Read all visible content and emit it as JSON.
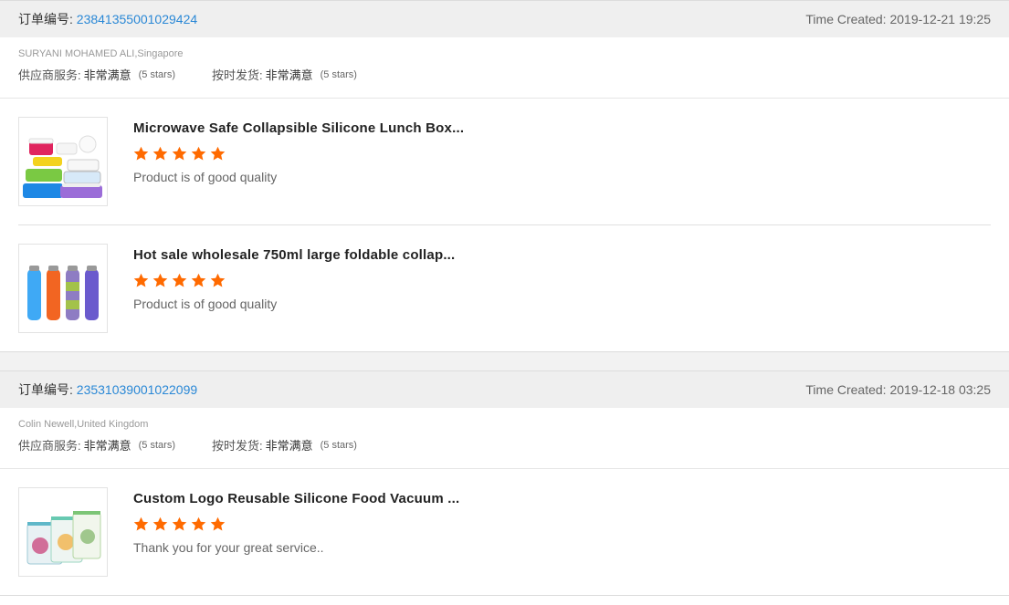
{
  "orders": [
    {
      "id_label": "订单编号:",
      "id": "23841355001029424",
      "time": "Time Created: 2019-12-21 19:25",
      "buyer": "SURYANI MOHAMED ALI,Singapore",
      "ratings": [
        {
          "label": "供应商服务:",
          "value": "非常满意",
          "stars": "(5 stars)"
        },
        {
          "label": "按时发货:",
          "value": "非常满意",
          "stars": "(5 stars)"
        }
      ],
      "products": [
        {
          "title": "Microwave Safe Collapsible Silicone Lunch Box...",
          "rating": 5,
          "comment": "Product is of good quality",
          "image": "lunch-box-image"
        },
        {
          "title": "Hot sale wholesale 750ml large foldable collap...",
          "rating": 5,
          "comment": "Product is of good quality",
          "image": "bottle-image"
        }
      ]
    },
    {
      "id_label": "订单编号:",
      "id": "23531039001022099",
      "time": "Time Created: 2019-12-18 03:25",
      "buyer": "Colin Newell,United Kingdom",
      "ratings": [
        {
          "label": "供应商服务:",
          "value": "非常满意",
          "stars": "(5 stars)"
        },
        {
          "label": "按时发货:",
          "value": "非常满意",
          "stars": "(5 stars)"
        }
      ],
      "products": [
        {
          "title": "Custom Logo Reusable Silicone Food Vacuum ...",
          "rating": 5,
          "comment": "Thank you for your great service..",
          "image": "food-bag-image"
        }
      ]
    }
  ],
  "colors": {
    "star": "#ff6a00",
    "link": "#2a88d6",
    "header_bg": "#efefef"
  }
}
